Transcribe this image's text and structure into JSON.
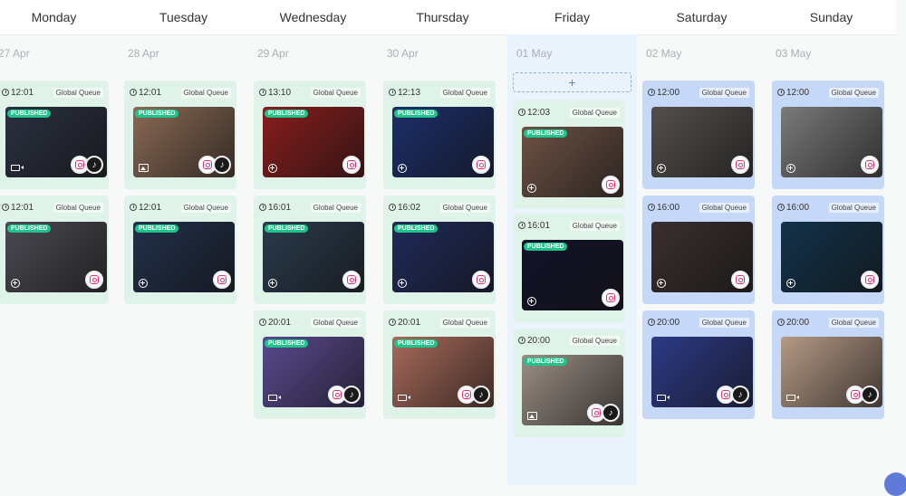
{
  "days": [
    {
      "name": "Monday",
      "date": "27 Apr",
      "today": false
    },
    {
      "name": "Tuesday",
      "date": "28 Apr",
      "today": false
    },
    {
      "name": "Wednesday",
      "date": "29 Apr",
      "today": false
    },
    {
      "name": "Thursday",
      "date": "30 Apr",
      "today": false
    },
    {
      "name": "Friday",
      "date": "01 May",
      "today": true
    },
    {
      "name": "Saturday",
      "date": "02 May",
      "today": false
    },
    {
      "name": "Sunday",
      "date": "03 May",
      "today": false
    }
  ],
  "add_label": "+",
  "queue_label": "Global Queue",
  "badge_label": "PUBLISHED",
  "colors": {
    "published_card": "#dff3e8",
    "scheduled_card": "#c6d8f7",
    "today_column": "#eaf3fb",
    "badge": "#1fc48a"
  },
  "posts": [
    {
      "day": 0,
      "slot": 0,
      "time": "12:01",
      "published": true,
      "media": "video-icon",
      "socials": [
        "instagram",
        "tiktok"
      ],
      "tone": "#2a3040"
    },
    {
      "day": 0,
      "slot": 1,
      "time": "12:01",
      "published": true,
      "media": "add-icon",
      "socials": [
        "instagram"
      ],
      "tone": "#4b4a52"
    },
    {
      "day": 1,
      "slot": 0,
      "time": "12:01",
      "published": true,
      "media": "image-icon",
      "socials": [
        "instagram",
        "tiktok"
      ],
      "tone": "#8a6a55"
    },
    {
      "day": 1,
      "slot": 1,
      "time": "12:01",
      "published": true,
      "media": "add-icon",
      "socials": [
        "instagram"
      ],
      "tone": "#22304a"
    },
    {
      "day": 2,
      "slot": 0,
      "time": "13:10",
      "published": true,
      "media": "add-icon",
      "socials": [
        "instagram"
      ],
      "tone": "#8a1d1d"
    },
    {
      "day": 2,
      "slot": 1,
      "time": "16:01",
      "published": true,
      "media": "add-icon",
      "socials": [
        "instagram"
      ],
      "tone": "#2a3a4c"
    },
    {
      "day": 2,
      "slot": 2,
      "time": "20:01",
      "published": true,
      "media": "video-icon",
      "socials": [
        "instagram",
        "tiktok"
      ],
      "tone": "#5a4a90"
    },
    {
      "day": 3,
      "slot": 0,
      "time": "12:13",
      "published": true,
      "media": "add-icon",
      "socials": [
        "instagram"
      ],
      "tone": "#1d2f6a"
    },
    {
      "day": 3,
      "slot": 1,
      "time": "16:02",
      "published": true,
      "media": "add-icon",
      "socials": [
        "instagram"
      ],
      "tone": "#202a5a"
    },
    {
      "day": 3,
      "slot": 2,
      "time": "20:01",
      "published": true,
      "media": "video-icon",
      "socials": [
        "instagram",
        "tiktok"
      ],
      "tone": "#a86a5a"
    },
    {
      "day": 4,
      "slot": 0,
      "time": "12:03",
      "published": true,
      "media": "add-icon",
      "socials": [
        "instagram"
      ],
      "tone": "#6d5245"
    },
    {
      "day": 4,
      "slot": 1,
      "time": "16:01",
      "published": true,
      "media": "add-icon",
      "socials": [
        "instagram"
      ],
      "tone": "#13122a"
    },
    {
      "day": 4,
      "slot": 2,
      "time": "20:00",
      "published": true,
      "media": "image-icon",
      "socials": [
        "instagram",
        "tiktok"
      ],
      "tone": "#9a8e84"
    },
    {
      "day": 5,
      "slot": 0,
      "time": "12:00",
      "published": false,
      "media": "add-icon",
      "socials": [
        "instagram"
      ],
      "tone": "#54504d"
    },
    {
      "day": 5,
      "slot": 1,
      "time": "16:00",
      "published": false,
      "media": "add-icon",
      "socials": [
        "instagram"
      ],
      "tone": "#3a2f2e"
    },
    {
      "day": 5,
      "slot": 2,
      "time": "20:00",
      "published": false,
      "media": "video-icon",
      "socials": [
        "instagram",
        "tiktok"
      ],
      "tone": "#2d3a86"
    },
    {
      "day": 6,
      "slot": 0,
      "time": "12:00",
      "published": false,
      "media": "add-icon",
      "socials": [
        "instagram"
      ],
      "tone": "#7a7a7a"
    },
    {
      "day": 6,
      "slot": 1,
      "time": "16:00",
      "published": false,
      "media": "add-icon",
      "socials": [
        "instagram"
      ],
      "tone": "#13324a"
    },
    {
      "day": 6,
      "slot": 2,
      "time": "20:00",
      "published": false,
      "media": "video-icon",
      "socials": [
        "instagram",
        "tiktok"
      ],
      "tone": "#b59a86"
    }
  ]
}
